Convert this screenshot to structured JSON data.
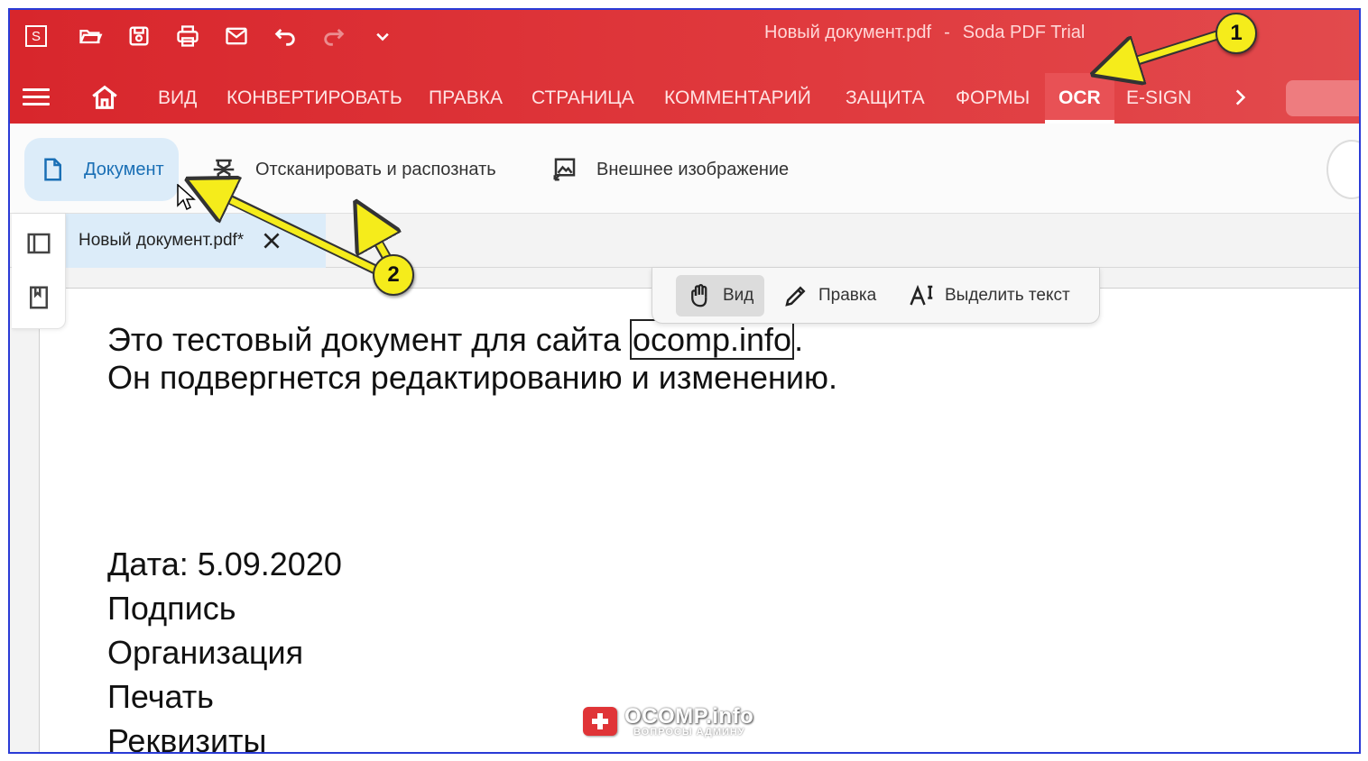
{
  "window": {
    "title_doc": "Новый документ.pdf",
    "title_sep": "-",
    "title_app": "Soda PDF Trial",
    "app_logo": "S"
  },
  "quick_access": [
    "open-folder-icon",
    "save-icon",
    "print-icon",
    "mail-icon",
    "undo-icon",
    "redo-icon",
    "chevron-down-icon"
  ],
  "tabs": {
    "items": [
      {
        "label": "ВИД"
      },
      {
        "label": "КОНВЕРТИРОВАТЬ"
      },
      {
        "label": "ПРАВКА"
      },
      {
        "label": "СТРАНИЦА"
      },
      {
        "label": "КОММЕНТАРИЙ"
      },
      {
        "label": "ЗАЩИТА"
      },
      {
        "label": "ФОРМЫ"
      },
      {
        "label": "OCR",
        "active": true
      },
      {
        "label": "E-SIGN"
      }
    ]
  },
  "ribbon": {
    "document": "Документ",
    "scan": "Отсканировать и распознать",
    "external_image": "Внешнее изображение"
  },
  "doc_tab": {
    "name": "Новый документ.pdf*"
  },
  "modes": {
    "view": "Вид",
    "edit": "Правка",
    "select_text": "Выделить текст"
  },
  "document": {
    "line1_before": "Это тестовый документ для сайта ",
    "line1_highlight": "ocomp.info",
    "line1_after": ".",
    "line2": "Он подвергнется редактированию и изменению.",
    "date": "Дата: 5.09.2020",
    "signature": "Подпись",
    "organization": "Организация",
    "stamp": "Печать",
    "requisites": "Реквизиты"
  },
  "watermark": {
    "brand": "OCOMP.info",
    "tagline": "ВОПРОСЫ АДМИНУ"
  },
  "annotations": {
    "step1": "1",
    "step2": "2"
  },
  "colors": {
    "brand_red": "#d8262c",
    "active_blue": "#1a6fb5",
    "annotation_yellow": "#f5ec1b",
    "frame_blue": "#2a3bd6"
  }
}
